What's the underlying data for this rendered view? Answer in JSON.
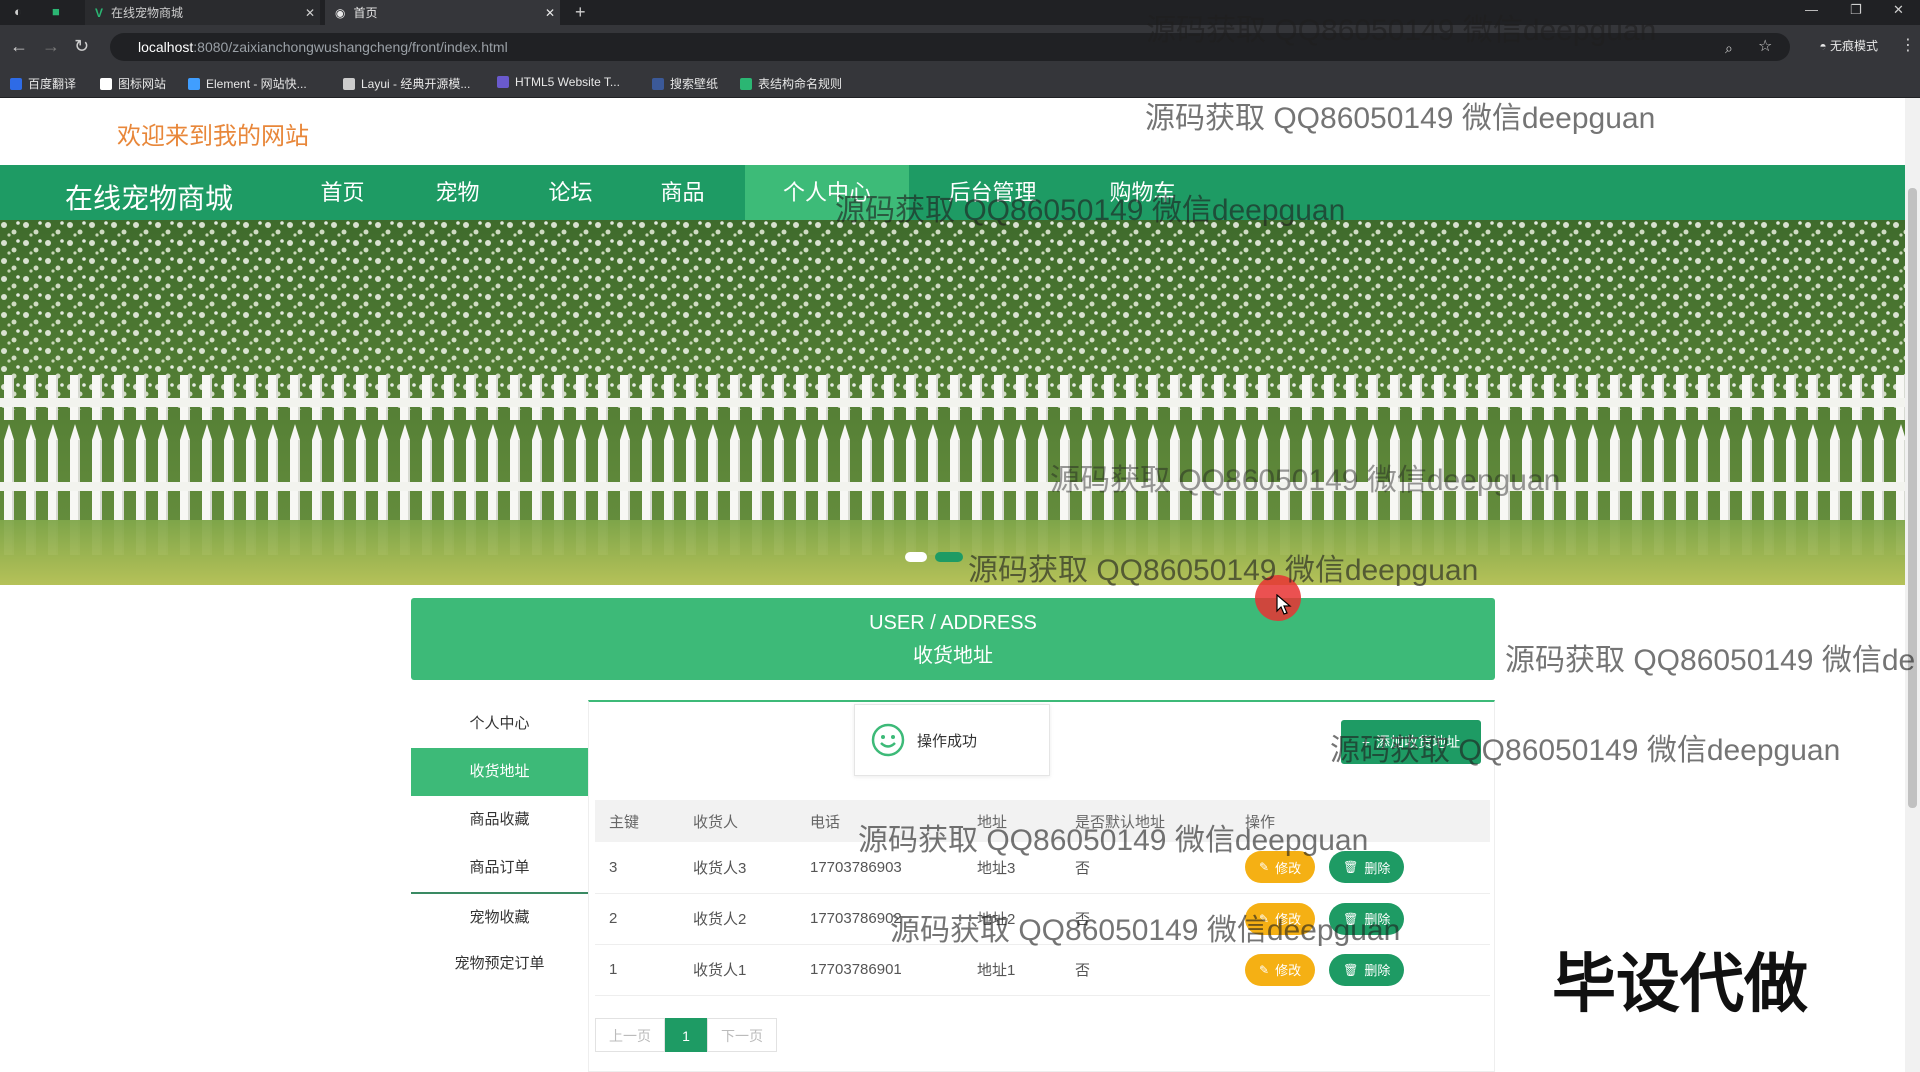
{
  "browser": {
    "tabs": [
      {
        "label": "在线宠物商城"
      },
      {
        "label": "首页"
      }
    ],
    "new_tab": "+",
    "url_host": "localhost",
    "url_path": ":8080/zaixianchongwushangcheng/front/index.html",
    "incognito_label": "无痕模式",
    "bookmarks": [
      {
        "label": "百度翻译",
        "color": "#2e6be6"
      },
      {
        "label": "图标网站",
        "color": "#ffffff"
      },
      {
        "label": "Element - 网站快...",
        "color": "#409eff"
      },
      {
        "label": "Layui - 经典开源模...",
        "color": "#cccccc"
      },
      {
        "label": "HTML5 Website T...",
        "color": "#6a5acd"
      },
      {
        "label": "搜索壁纸",
        "color": "#3b5998"
      },
      {
        "label": "表结构命名规则",
        "color": "#2bb673"
      }
    ]
  },
  "header": {
    "welcome": "欢迎来到我的网站"
  },
  "nav": {
    "brand": "在线宠物商城",
    "items": [
      {
        "label": "首页"
      },
      {
        "label": "宠物"
      },
      {
        "label": "论坛"
      },
      {
        "label": "商品"
      },
      {
        "label": "个人中心",
        "active": true
      },
      {
        "label": "后台管理"
      },
      {
        "label": "购物车"
      }
    ]
  },
  "section": {
    "title_en": "USER / ADDRESS",
    "title_cn": "收货地址"
  },
  "sidebar": {
    "items": [
      {
        "label": "个人中心"
      },
      {
        "label": "收货地址",
        "active": true
      },
      {
        "label": "商品收藏"
      },
      {
        "label": "商品订单"
      },
      {
        "label": "宠物收藏"
      },
      {
        "label": "宠物预定订单"
      }
    ]
  },
  "toast": {
    "message": "操作成功"
  },
  "add_button": "添加收货地址",
  "table": {
    "columns": [
      "主键",
      "收货人",
      "电话",
      "地址",
      "是否默认地址",
      "操作"
    ],
    "rows": [
      {
        "id": "3",
        "name": "收货人3",
        "phone": "17703786903",
        "address": "地址3",
        "default": "否"
      },
      {
        "id": "2",
        "name": "收货人2",
        "phone": "17703786902",
        "address": "地址2",
        "default": "否"
      },
      {
        "id": "1",
        "name": "收货人1",
        "phone": "17703786901",
        "address": "地址1",
        "default": "否"
      }
    ],
    "edit_label": "修改",
    "delete_label": "删除"
  },
  "pagination": {
    "prev": "上一页",
    "current": "1",
    "next": "下一页"
  },
  "watermarks": [
    "源码获取 QQ86050149 微信deepguan",
    "源码获取 QQ86050149 微信deepguan",
    "源码获取 QQ86050149 微信deepguan",
    "源码获取 QQ86050149 微信deepguan",
    "源码获取 QQ86050149 微信deepguan",
    "源码获取 QQ86050149 微信de",
    "源码获取 QQ86050149 微信deepguan",
    "源码获取 QQ86050149 微信deepguan",
    "源码获取 QQ86050149 微信deepguan"
  ],
  "promo_text": "毕设代做",
  "colors": {
    "primary": "#1e9b64",
    "accent": "#3dba78",
    "warning": "#f5b014",
    "welcome": "#e8873a"
  }
}
